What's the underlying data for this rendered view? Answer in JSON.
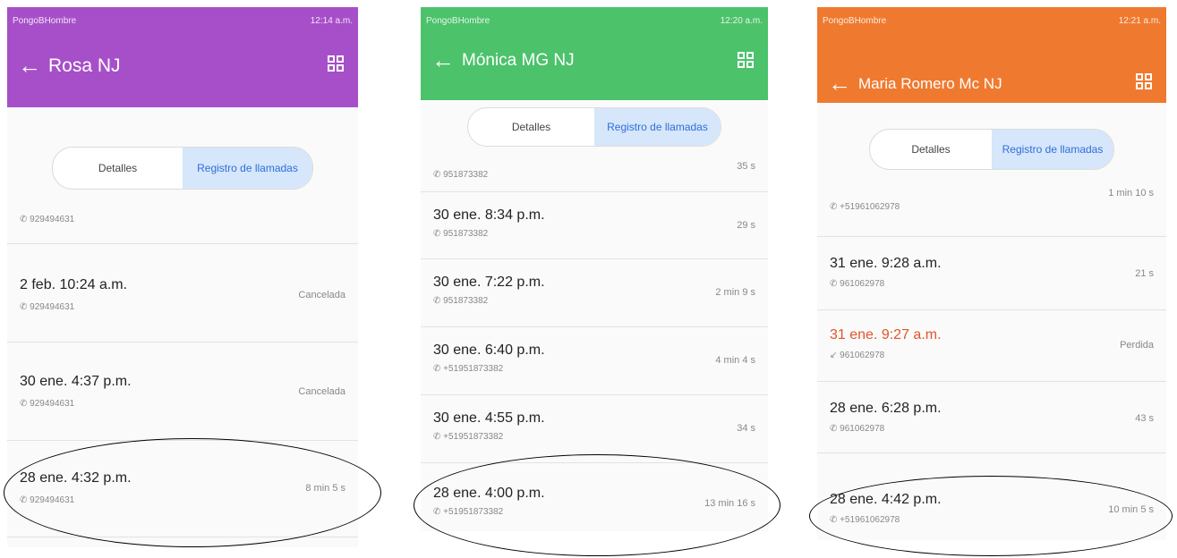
{
  "phones": [
    {
      "accent": "#a74fc9",
      "status_left": "PongoBHombre",
      "status_right": "12:14 a.m.",
      "contact_name": "Rosa NJ",
      "tabs": [
        "Detalles",
        "Registro de llamadas"
      ],
      "active_tab": 1,
      "calls": [
        {
          "datetime": "",
          "number": "929494631",
          "duration": "",
          "missed": false
        },
        {
          "datetime": "2 feb. 10:24 a.m.",
          "number": "929494631",
          "duration": "Cancelada",
          "missed": false
        },
        {
          "datetime": "30 ene. 4:37 p.m.",
          "number": "929494631",
          "duration": "Cancelada",
          "missed": false
        },
        {
          "datetime": "28 ene. 4:32 p.m.",
          "number": "929494631",
          "duration": "8 min 5 s",
          "missed": false
        }
      ]
    },
    {
      "accent": "#4cc26b",
      "status_left": "PongoBHombre",
      "status_right": "12:20 a.m.",
      "contact_name": "Mónica MG NJ",
      "tabs": [
        "Detalles",
        "Registro de llamadas"
      ],
      "active_tab": 1,
      "calls": [
        {
          "datetime": "",
          "number": "951873382",
          "duration": "35 s",
          "missed": false
        },
        {
          "datetime": "30 ene. 8:34 p.m.",
          "number": "951873382",
          "duration": "29 s",
          "missed": false
        },
        {
          "datetime": "30 ene. 7:22 p.m.",
          "number": "951873382",
          "duration": "2 min 9 s",
          "missed": false
        },
        {
          "datetime": "30 ene. 6:40 p.m.",
          "number": "+51951873382",
          "duration": "4 min 4 s",
          "missed": false
        },
        {
          "datetime": "30 ene. 4:55 p.m.",
          "number": "+51951873382",
          "duration": "34 s",
          "missed": false
        },
        {
          "datetime": "28 ene. 4:00 p.m.",
          "number": "+51951873382",
          "duration": "13 min 16 s",
          "missed": false
        }
      ]
    },
    {
      "accent": "#ef7a2f",
      "status_left": "PongoBHombre",
      "status_right": "12:21 a.m.",
      "contact_name": "Maria Romero Mc NJ",
      "tabs": [
        "Detalles",
        "Registro de llamadas"
      ],
      "active_tab": 1,
      "calls": [
        {
          "datetime": "",
          "number": "+51961062978",
          "duration": "1 min 10 s",
          "missed": false
        },
        {
          "datetime": "31 ene. 9:28 a.m.",
          "number": "961062978",
          "duration": "21 s",
          "missed": false
        },
        {
          "datetime": "31 ene. 9:27 a.m.",
          "number": "961062978",
          "duration": "Perdida",
          "missed": true
        },
        {
          "datetime": "28 ene. 6:28 p.m.",
          "number": "961062978",
          "duration": "43 s",
          "missed": false
        },
        {
          "datetime": "28 ene. 4:42 p.m.",
          "number": "+51961062978",
          "duration": "10 min 5 s",
          "missed": false
        }
      ]
    }
  ],
  "icons": {
    "back": "arrow-left-icon",
    "qr": "qr-code-icon",
    "phone": "phone-icon",
    "missed": "missed-call-icon"
  }
}
